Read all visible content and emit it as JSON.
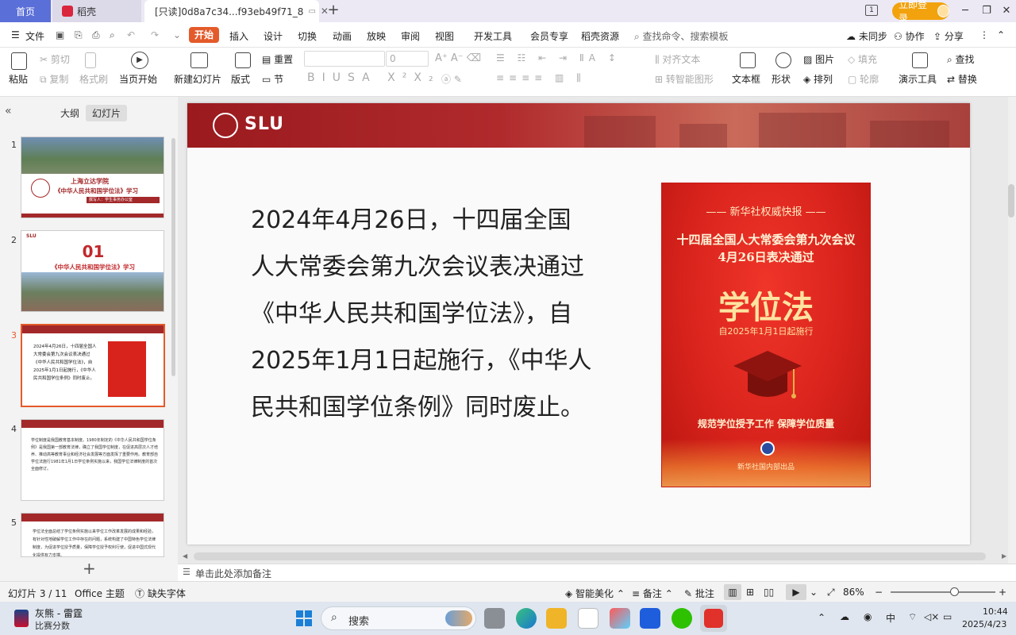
{
  "titlebar": {
    "home_tab": "首页",
    "daoke_tab": "稻壳",
    "doc_tab": "[只读]0d8a7c34...f93eb49f71_8",
    "login_label": "立即登录",
    "colors": {
      "home": "#5b6fd8",
      "login": "#f2a20d",
      "doc_icon": "#e45a2a",
      "daoke_icon": "#d9263c"
    }
  },
  "menu": {
    "file": "文件",
    "tabs": [
      "开始",
      "插入",
      "设计",
      "切换",
      "动画",
      "放映",
      "审阅",
      "视图",
      "开发工具",
      "会员专享",
      "稻壳资源"
    ],
    "search": "查找命令、搜索模板",
    "sync": "未同步",
    "collab": "协作",
    "share": "分享",
    "active_color": "#e45a2a"
  },
  "ribbon": {
    "paste": "粘贴",
    "cut": "剪切",
    "copy": "复制",
    "format_painter": "格式刷",
    "play_from_current": "当页开始",
    "new_slide": "新建幻灯片",
    "layout": "版式",
    "reset": "重置",
    "section": "节",
    "font_size": "0",
    "align_text": "对齐文本",
    "convert_smartart": "转智能图形",
    "textbox": "文本框",
    "shape": "形状",
    "picture": "图片",
    "arrange": "排列",
    "fill": "填充",
    "outline": "轮廓",
    "presenter_tools": "演示工具",
    "find": "查找",
    "replace": "替换"
  },
  "leftpanel": {
    "outline_tab": "大纲",
    "slides_tab": "幻灯片",
    "thumbs": [
      {
        "num": "1",
        "title": "上海立达学院",
        "subtitle": "《中华人民共和国学位法》学习",
        "presenter": "撰写人：学生事务办公室"
      },
      {
        "num": "2",
        "big": "01",
        "subtitle": "《中华人民共和国学位法》学习"
      },
      {
        "num": "3",
        "text": "2024年4月26日，十四届全国人大常委会第九次会议表决通过《中华人民共和国学位法》，自2025年1月1日起施行，《中华人民共和国学位条例》同时废止。"
      },
      {
        "num": "4",
        "text": "学位制度是我国教育基本制度。1980年制定的《中华人民共和国学位条例》是我国第一部教育法律，确立了我国学位制度，在促进高层次人才培养、推动高等教育事业和经济社会发展等方面发挥了重要作用。教育部自学位法施行1981年1月1日学位条例实施以来，我国学位法律制度的首次全面修订。"
      },
      {
        "num": "5",
        "text": "学位法全面总结了学位条例实施以来学位工作改革发展的成果和经验，有针对性地破解学位工作中存在的问题，系统构建了中国特色学位法律制度，为促进学位授予质量，保障学位授予权利行使，促进中国式现代化提供有力支撑。"
      }
    ],
    "brand": "SLU"
  },
  "slide": {
    "brand": "SLU",
    "body": "2024年4月26日，十四届全国人大常委会第九次会议表决通过《中华人民共和国学位法》，自2025年1月1日起施行，《中华人民共和国学位条例》同时废止。",
    "poster": {
      "head": "新华社权威快报",
      "title_line1": "十四届全国人大常委会第九次会议",
      "title_line2": "4月26日表决通过",
      "big": "学位法",
      "date": "自2025年1月1日起施行",
      "slogan": "规范学位授予工作   保障学位质量",
      "footer": "新华社国内部出品"
    }
  },
  "notes": {
    "placeholder": "单击此处添加备注"
  },
  "statusbar": {
    "slide_index": "幻灯片 3 / 11",
    "theme": "Office 主题",
    "missing_font": "缺失字体",
    "beautify": "智能美化",
    "notes": "备注",
    "comments": "批注",
    "zoom": "86%",
    "zoom_level": 0.86
  },
  "taskbar": {
    "weather_title": "灰熊 - 雷霆",
    "weather_sub": "比赛分数",
    "search": "搜索",
    "ime": "中",
    "time": "10:44",
    "date": "2025/4/23"
  }
}
